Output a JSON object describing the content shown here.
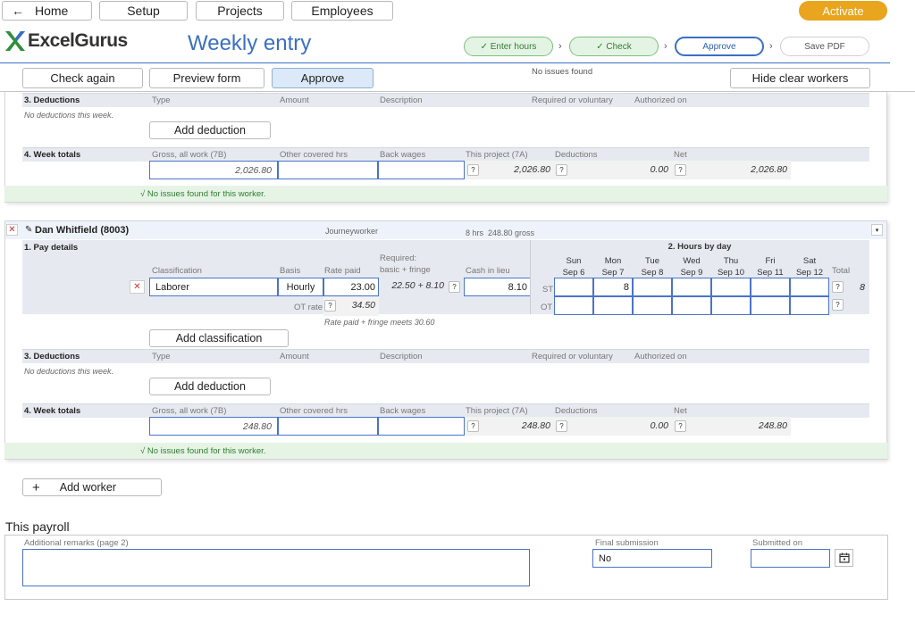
{
  "nav": {
    "home": "Home",
    "setup": "Setup",
    "projects": "Projects",
    "employees": "Employees",
    "activate": "Activate",
    "back_icon": "arrow-left-icon"
  },
  "brand": {
    "logo": "ExcelGurus",
    "page_title": "Weekly entry"
  },
  "steps": [
    "✓ Enter hours",
    "✓ Check",
    "Approve",
    "Save PDF"
  ],
  "toolbar": {
    "check_again": "Check again",
    "preview_form": "Preview form",
    "approve": "Approve",
    "status": "No issues found",
    "hide_clear": "Hide clear workers"
  },
  "worker1": {
    "deductions": {
      "title": "3. Deductions",
      "cols": [
        "Type",
        "Amount",
        "Description",
        "Required or voluntary",
        "Authorized on"
      ],
      "empty": "No deductions this week.",
      "add": "Add deduction"
    },
    "totals": {
      "title": "4. Week totals",
      "cols": [
        "Gross, all work (7B)",
        "Other covered hrs",
        "Back wages",
        "This project (7A)",
        "Deductions",
        "Net"
      ],
      "gross": "2,026.80",
      "this_project": "2,026.80",
      "deductions": "0.00",
      "net": "2,026.80",
      "q": "?"
    },
    "ok": "√ No issues found for this worker."
  },
  "worker2": {
    "name": "Dan Whitfield (8003)",
    "type": "Journeyworker",
    "summary": "8 hrs  248.80 gross",
    "pay": {
      "title": "1. Pay details",
      "classification_label": "Classification",
      "basis_label": "Basis",
      "rate_label": "Rate paid",
      "required_label": "Required:",
      "required_sub": "basic + fringe",
      "cash_label": "Cash in lieu",
      "classification": "Laborer",
      "basis": "Hourly",
      "rate": "23.00",
      "required": "22.50 + 8.10",
      "cash": "8.10",
      "ot_label": "OT rate",
      "ot_rate": "34.50",
      "fringe_note": "Rate paid + fringe meets 30.60",
      "add_class": "Add classification"
    },
    "hours": {
      "title": "2. Hours by day",
      "days": [
        {
          "d": "Sun",
          "date": "Sep 6"
        },
        {
          "d": "Mon",
          "date": "Sep 7"
        },
        {
          "d": "Tue",
          "date": "Sep 8"
        },
        {
          "d": "Wed",
          "date": "Sep 9"
        },
        {
          "d": "Thu",
          "date": "Sep 10"
        },
        {
          "d": "Fri",
          "date": "Sep 11"
        },
        {
          "d": "Sat",
          "date": "Sep 12"
        }
      ],
      "total_label": "Total",
      "st_label": "ST",
      "ot_label": "OT",
      "st": [
        "",
        "8",
        "",
        "",
        "",
        "",
        ""
      ],
      "ot": [
        "",
        "",
        "",
        "",
        "",
        "",
        ""
      ],
      "st_total": "8",
      "ot_total": ""
    },
    "deductions": {
      "title": "3. Deductions",
      "cols": [
        "Type",
        "Amount",
        "Description",
        "Required or voluntary",
        "Authorized on"
      ],
      "empty": "No deductions this week.",
      "add": "Add deduction"
    },
    "totals": {
      "title": "4. Week totals",
      "cols": [
        "Gross, all work (7B)",
        "Other covered hrs",
        "Back wages",
        "This project (7A)",
        "Deductions",
        "Net"
      ],
      "gross": "248.80",
      "this_project": "248.80",
      "deductions": "0.00",
      "net": "248.80"
    },
    "ok": "√ No issues found for this worker."
  },
  "add_worker": {
    "plus": "+",
    "label": "Add worker"
  },
  "payroll": {
    "title": "This payroll",
    "remarks_label": "Additional remarks (page 2)",
    "final_label": "Final submission",
    "final_value": "No",
    "submitted_label": "Submitted on",
    "submitted_value": ""
  },
  "colors": {
    "accent": "#e8a51d",
    "blue": "#4a74c9",
    "green": "#2f7d2f"
  }
}
